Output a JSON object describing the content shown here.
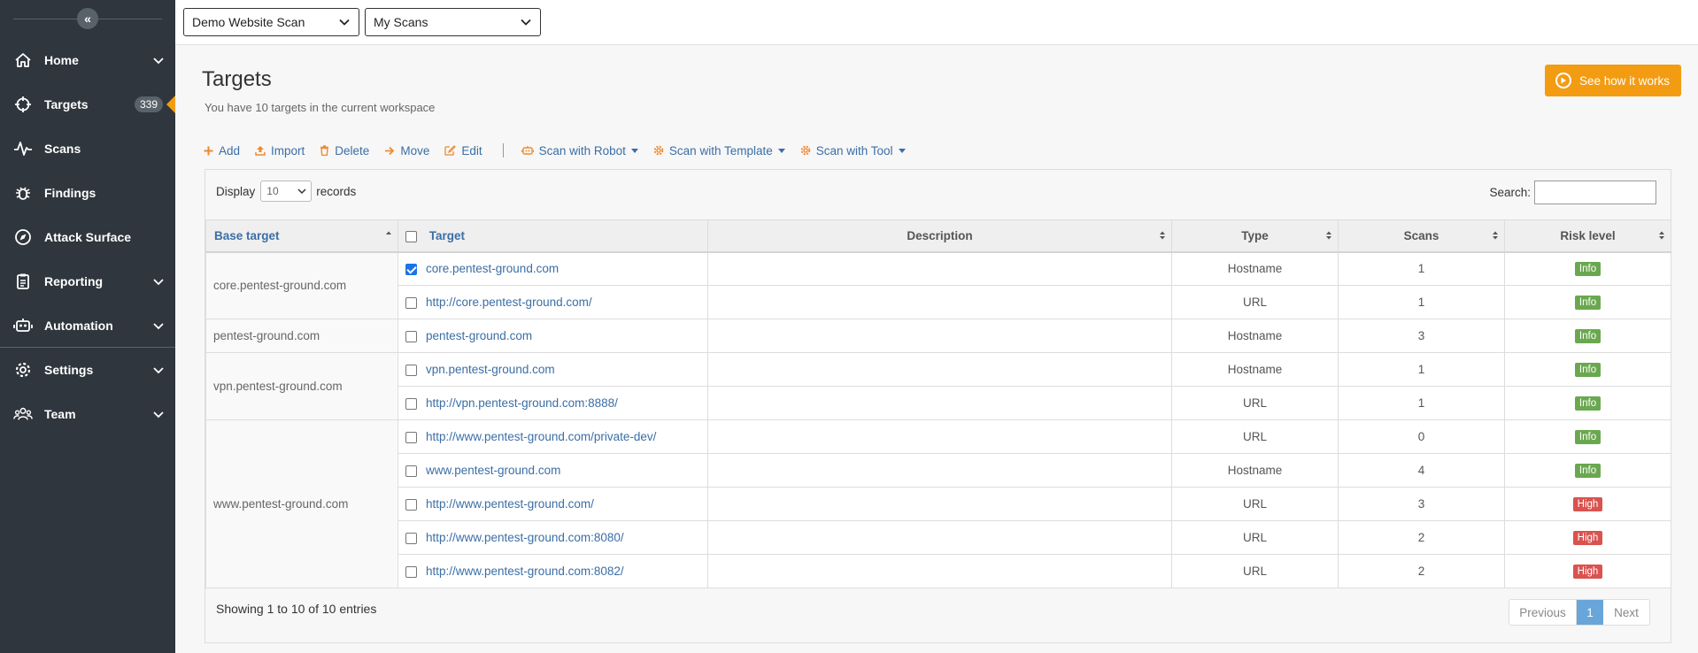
{
  "sidebar": {
    "items": [
      {
        "label": "Home",
        "icon": "home-icon",
        "expandable": true
      },
      {
        "label": "Targets",
        "icon": "crosshair-icon",
        "badge": "339",
        "active": true
      },
      {
        "label": "Scans",
        "icon": "activity-icon"
      },
      {
        "label": "Findings",
        "icon": "bug-icon"
      },
      {
        "label": "Attack Surface",
        "icon": "compass-icon"
      },
      {
        "label": "Reporting",
        "icon": "clipboard-icon",
        "expandable": true
      },
      {
        "label": "Automation",
        "icon": "robot-icon",
        "expandable": true
      },
      {
        "label": "Settings",
        "icon": "gear-icon",
        "expandable": true
      },
      {
        "label": "Team",
        "icon": "team-icon",
        "expandable": true
      }
    ]
  },
  "topbar": {
    "workspace": "Demo Website Scan",
    "scans_filter": "My Scans"
  },
  "page": {
    "title": "Targets",
    "subtitle": "You have 10 targets in the current workspace",
    "how_button": "See how it works"
  },
  "toolbar": {
    "add": "Add",
    "import": "Import",
    "delete": "Delete",
    "move": "Move",
    "edit": "Edit",
    "scan_robot": "Scan with Robot",
    "scan_template": "Scan with Template",
    "scan_tool": "Scan with Tool"
  },
  "table_controls": {
    "display_label": "Display",
    "display_value": "10",
    "records_label": "records",
    "search_label": "Search:",
    "search_value": ""
  },
  "table": {
    "columns": [
      "Base target",
      "Target",
      "Description",
      "Type",
      "Scans",
      "Risk level"
    ],
    "groups": [
      {
        "base": "core.pentest-ground.com",
        "rows": [
          {
            "target": "core.pentest-ground.com",
            "checked": true,
            "description": "",
            "type": "Hostname",
            "scans": "1",
            "risk": "Info"
          },
          {
            "target": "http://core.pentest-ground.com/",
            "checked": false,
            "description": "",
            "type": "URL",
            "scans": "1",
            "risk": "Info"
          }
        ]
      },
      {
        "base": "pentest-ground.com",
        "rows": [
          {
            "target": "pentest-ground.com",
            "checked": false,
            "description": "",
            "type": "Hostname",
            "scans": "3",
            "risk": "Info"
          }
        ]
      },
      {
        "base": "vpn.pentest-ground.com",
        "rows": [
          {
            "target": "vpn.pentest-ground.com",
            "checked": false,
            "description": "",
            "type": "Hostname",
            "scans": "1",
            "risk": "Info"
          },
          {
            "target": "http://vpn.pentest-ground.com:8888/",
            "checked": false,
            "description": "",
            "type": "URL",
            "scans": "1",
            "risk": "Info"
          }
        ]
      },
      {
        "base": "www.pentest-ground.com",
        "rows": [
          {
            "target": "http://www.pentest-ground.com/private-dev/",
            "checked": false,
            "description": "",
            "type": "URL",
            "scans": "0",
            "risk": "Info"
          },
          {
            "target": "www.pentest-ground.com",
            "checked": false,
            "description": "",
            "type": "Hostname",
            "scans": "4",
            "risk": "Info"
          },
          {
            "target": "http://www.pentest-ground.com/",
            "checked": false,
            "description": "",
            "type": "URL",
            "scans": "3",
            "risk": "High"
          },
          {
            "target": "http://www.pentest-ground.com:8080/",
            "checked": false,
            "description": "",
            "type": "URL",
            "scans": "2",
            "risk": "High"
          },
          {
            "target": "http://www.pentest-ground.com:8082/",
            "checked": false,
            "description": "",
            "type": "URL",
            "scans": "2",
            "risk": "High"
          }
        ]
      }
    ]
  },
  "footer": {
    "info": "Showing 1 to 10 of 10 entries",
    "prev": "Previous",
    "page": "1",
    "next": "Next"
  },
  "colors": {
    "sidebar_bg": "#2f363d",
    "accent": "#f39c12",
    "link": "#3b6ea5",
    "risk_info": "#6aa84f",
    "risk_high": "#d9534f"
  }
}
